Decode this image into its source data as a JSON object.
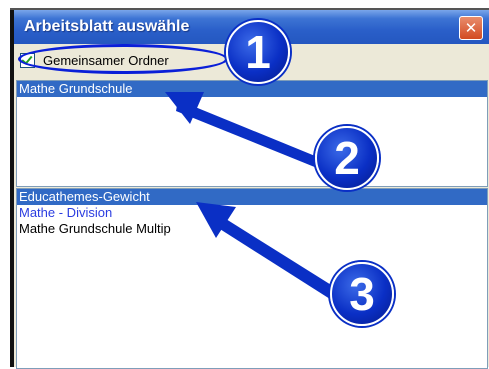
{
  "window": {
    "title": "Arbeitsblatt auswähle",
    "close_glyph": "✕"
  },
  "shared_folder": {
    "label": "Gemeinsamer Ordner",
    "checked": true
  },
  "folders": {
    "items": [
      {
        "label": "Mathe Grundschule",
        "selected": true
      }
    ]
  },
  "worksheets": {
    "items": [
      {
        "label": "Educathemes-Gewicht",
        "selected": true
      },
      {
        "label": "Mathe - Division",
        "selected": false
      },
      {
        "label": "Mathe Grundschule Multip",
        "selected": false
      }
    ]
  },
  "annotations": {
    "badge_1": "1",
    "badge_2": "2",
    "badge_3": "3",
    "color": "#0a2fc5"
  },
  "colors": {
    "titlebar": "#2a5fc9",
    "selection": "#316ac5",
    "close_button": "#d24a22"
  }
}
